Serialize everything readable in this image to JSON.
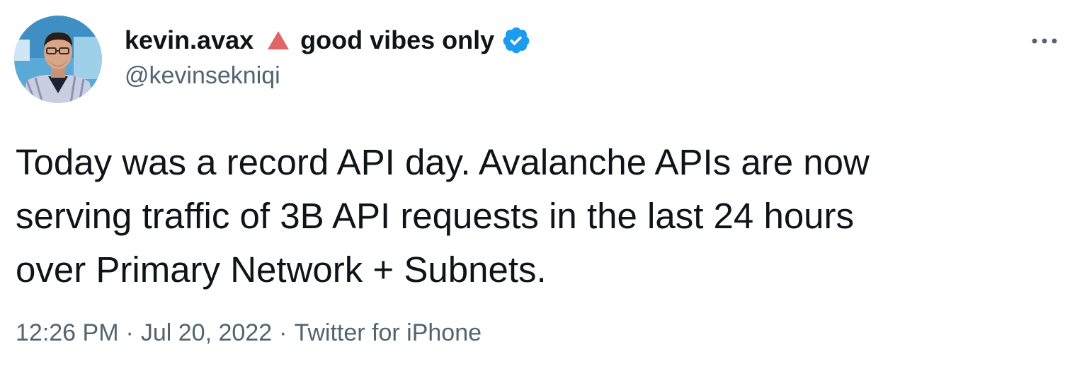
{
  "author": {
    "display_name": "kevin.avax",
    "display_suffix": "good vibes only",
    "handle": "@kevinsekniqi",
    "name_icon": "avalanche-triangle-icon",
    "verified_icon": "verified-badge-icon",
    "avatar_icon": "avatar"
  },
  "tweet": {
    "text": "Today was a record API day. Avalanche APIs are now\nserving traffic of 3B API requests in the last 24 hours\nover Primary Network + Subnets."
  },
  "meta": {
    "time": "12:26 PM",
    "date": "Jul 20, 2022",
    "separator": "·",
    "source": "Twitter for iPhone"
  },
  "menu": {
    "icon": "more-horizontal-icon"
  },
  "colors": {
    "text": "#0f1419",
    "secondary_text": "#536471",
    "verified_blue": "#1d9bf0",
    "avax_red": "#e84142"
  }
}
